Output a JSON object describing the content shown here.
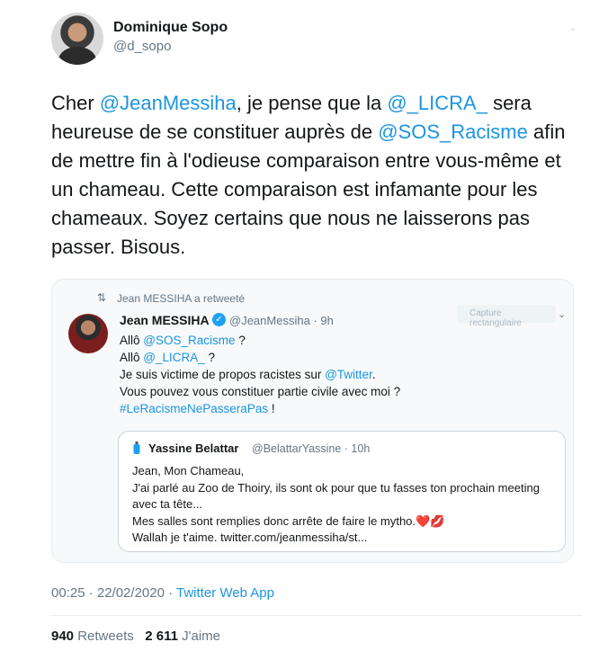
{
  "author": {
    "name": "Dominique Sopo",
    "handle": "@d_sopo"
  },
  "tweet": {
    "t1": "Cher ",
    "m1": "@JeanMessiha",
    "t2": ", je pense que la ",
    "m2": "@_LICRA_",
    "t3": " sera heureuse de se constituer auprès de ",
    "m3": "@SOS_Racisme",
    "t4": " afin de mettre fin à l'odieuse comparaison entre vous-même et un chameau. Cette comparaison est infamante pour les chameaux. Soyez certains que nous ne laisserons pas passer. Bisous."
  },
  "retweet": {
    "retweeted_by": "Jean MESSIHA a retweeté",
    "name": "Jean MESSIHA",
    "handle": "@JeanMessiha",
    "time": "9h",
    "capture_label": "Capture rectangulaire",
    "l1a": "Allô ",
    "l1m": "@SOS_Racisme",
    "l1b": " ?",
    "l2a": "Allô ",
    "l2m": "@_LICRA_",
    "l2b": " ?",
    "l3a": "Je suis victime de propos racistes sur ",
    "l3m": "@Twitter",
    "l3b": ".",
    "l4": "Vous pouvez vous constituer partie civile avec moi ?",
    "l5m": "#LeRacismeNePasseraPas",
    "l5b": " !"
  },
  "quote": {
    "name": "Yassine Belattar",
    "handle": "@BelattarYassine",
    "time": "10h",
    "q1": "Jean, Mon Chameau,",
    "q2": "J'ai parlé au Zoo de Thoiry, ils sont ok pour que tu fasses ton prochain meeting avec ta tête...",
    "q3": "Mes salles sont remplies donc arrête de faire le mytho.",
    "q3emoji": "❤️💋",
    "q4": "Wallah je t'aime. twitter.com/jeanmessiha/st..."
  },
  "meta": {
    "time": "00:25 · 22/02/2020 · ",
    "app": "Twitter Web App"
  },
  "stats": {
    "retweets_count": "940",
    "retweets_label": "Retweets",
    "likes_count": "2 611",
    "likes_label": "J'aime"
  },
  "icons": {
    "retweet": "retweet-icon",
    "verified": "verified-badge-icon",
    "caret": "chevron-down-icon"
  },
  "colors": {
    "link": "#1b95e0",
    "muted": "#657786",
    "verified": "#1da1f2"
  }
}
